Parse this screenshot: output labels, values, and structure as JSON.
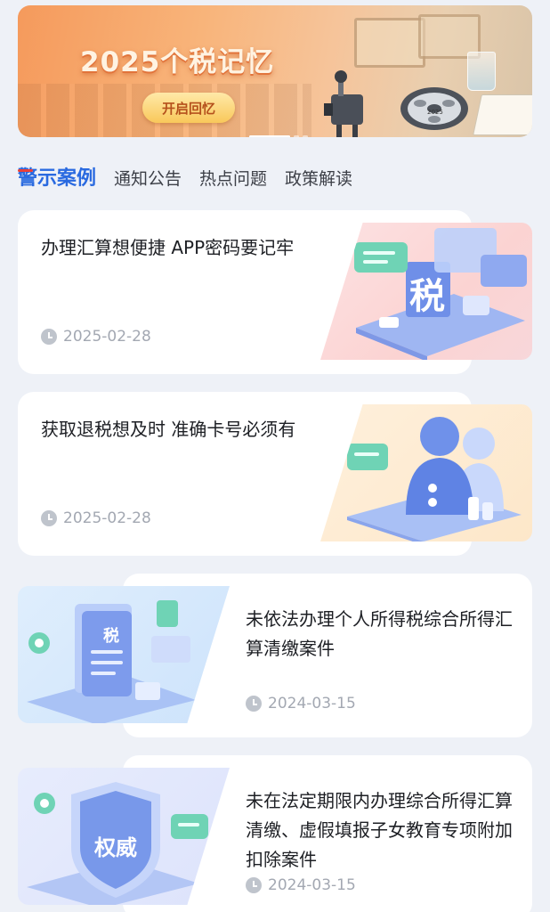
{
  "banner": {
    "title": "2025个税记忆",
    "button_label": "开启回忆",
    "reel_label": "2025"
  },
  "tabs": [
    {
      "label": "警示案例",
      "active": true
    },
    {
      "label": "通知公告",
      "active": false
    },
    {
      "label": "热点问题",
      "active": false
    },
    {
      "label": "政策解读",
      "active": false
    }
  ],
  "articles": [
    {
      "title": "办理汇算想便捷 APP密码要记牢",
      "date": "2025-02-28",
      "icon": "tax-illustration",
      "art_text": "税"
    },
    {
      "title": "获取退税想及时 准确卡号必须有",
      "date": "2025-02-28",
      "icon": "people-illustration"
    },
    {
      "title": "未依法办理个人所得税综合所得汇算清缴案件",
      "date": "2024-03-15",
      "icon": "tax-document-illustration",
      "art_text": "税"
    },
    {
      "title": "未在法定期限内办理综合所得汇算清缴、虚假填报子女教育专项附加扣除案件",
      "date": "2024-03-15",
      "icon": "authority-shield-illustration",
      "art_text": "权威"
    }
  ]
}
